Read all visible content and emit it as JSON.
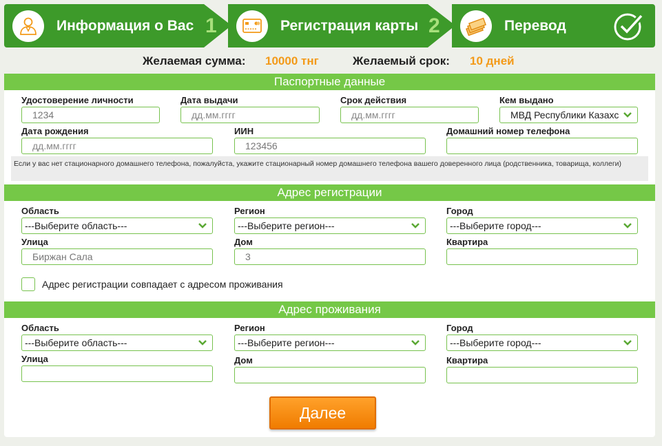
{
  "steps": [
    {
      "label": "Информация о Вас",
      "num": "1",
      "icon": "person-icon"
    },
    {
      "label": "Регистрация карты",
      "num": "2",
      "icon": "card-icon"
    },
    {
      "label": "Перевод",
      "icon": "money-icon"
    }
  ],
  "summary": {
    "amount_label": "Желаемая сумма:",
    "amount_value": "10000 тнг",
    "term_label": "Желаемый срок:",
    "term_value": "10 дней"
  },
  "passport": {
    "title": "Паспортные данные",
    "id_label": "Удостоверение личности",
    "id_value": "1234",
    "issue_date_label": "Дата выдачи",
    "issue_date_placeholder": "дд.мм.гггг",
    "expiry_label": "Срок действия",
    "expiry_placeholder": "дд.мм.гггг",
    "issued_by_label": "Кем выдано",
    "issued_by_value": "МВД Республики Казахс",
    "birth_label": "Дата рождения",
    "birth_placeholder": "дд.мм.гггг",
    "iin_label": "ИИН",
    "iin_value": "123456",
    "phone_label": "Домашний номер телефона",
    "phone_value": "",
    "note": "Если у вас нет стационарного домашнего телефона, пожалуйста, укажите стационарный номер домашнего телефона вашего доверенного лица (родственника, товарища, коллеги)"
  },
  "registration": {
    "title": "Адрес регистрации",
    "region_label": "Область",
    "region_value": "---Выберите область---",
    "district_label": "Регион",
    "district_value": "---Выберите регион---",
    "city_label": "Город",
    "city_value": "---Выберите город---",
    "street_label": "Улица",
    "street_value": "Биржан Сала",
    "house_label": "Дом",
    "house_value": "3",
    "apt_label": "Квартира",
    "apt_value": "",
    "same_address_label": "Адрес регистрации совпадает с адресом проживания",
    "same_address_checked": false
  },
  "residence": {
    "title": "Адрес проживания",
    "region_label": "Область",
    "region_value": "---Выберите область---",
    "district_label": "Регион",
    "district_value": "---Выберите регион---",
    "city_label": "Город",
    "city_value": "---Выберите город---",
    "street_label": "Улица",
    "house_label": "Дом",
    "apt_label": "Квартира"
  },
  "next_button": "Далее",
  "colors": {
    "step_green": "#3d9a2a",
    "section_green": "#75c847",
    "accent_orange": "#f39a19"
  }
}
